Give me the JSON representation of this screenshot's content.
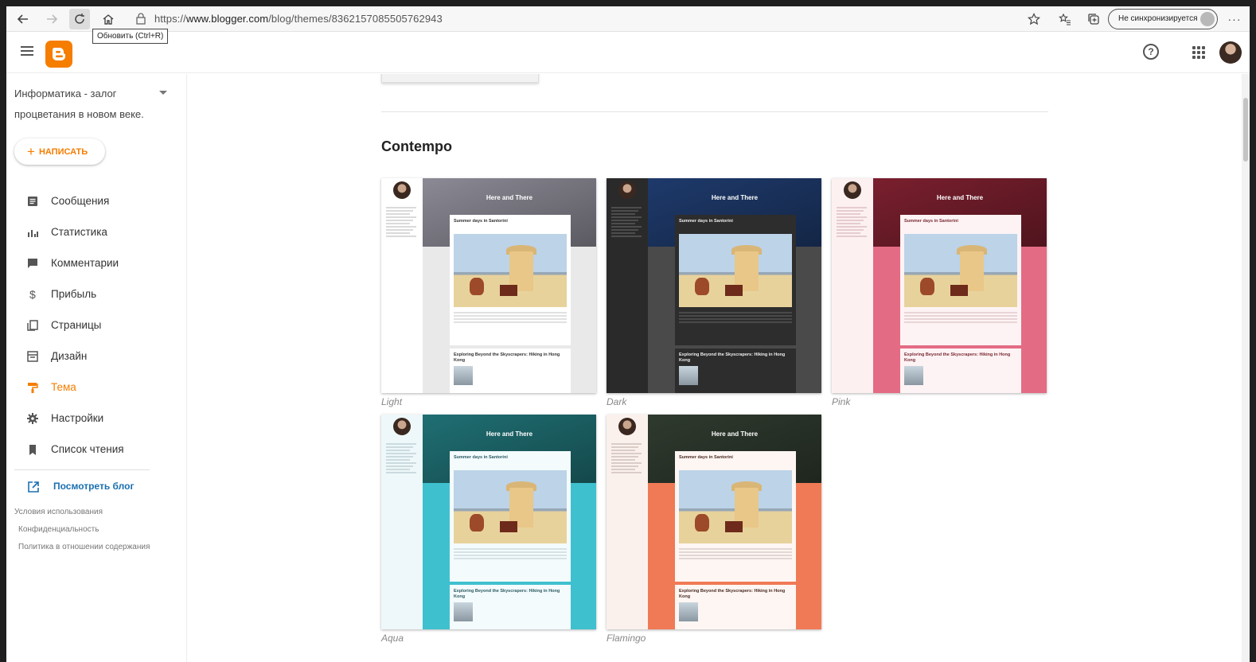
{
  "browser": {
    "url_prefix": "https://",
    "url_domain": "www.blogger.com",
    "url_path": "/blog/themes/8362157085505762943",
    "tooltip": "Обновить (Ctrl+R)",
    "sync_label": "Не синхронизируется",
    "icons": [
      "back-icon",
      "forward-icon",
      "refresh-icon",
      "home-icon",
      "lock-icon",
      "star-icon",
      "favorites-icon",
      "collections-icon",
      "more-icon"
    ]
  },
  "sidebar": {
    "blog_name": "Информатика - залог процветания в новом веке.",
    "write_label": "НАПИСАТЬ",
    "items": [
      {
        "label": "Сообщения",
        "icon": "posts-icon"
      },
      {
        "label": "Статистика",
        "icon": "stats-icon"
      },
      {
        "label": "Комментарии",
        "icon": "comments-icon"
      },
      {
        "label": "Прибыль",
        "icon": "dollar-icon"
      },
      {
        "label": "Страницы",
        "icon": "pages-icon"
      },
      {
        "label": "Дизайн",
        "icon": "layout-icon"
      },
      {
        "label": "Тема",
        "icon": "paint-roller-icon",
        "active": true
      },
      {
        "label": "Настройки",
        "icon": "gear-icon"
      },
      {
        "label": "Список чтения",
        "icon": "bookmark-icon"
      }
    ],
    "view_blog": "Посмотреть блог",
    "footer": [
      "Условия использования",
      "Конфиденциальность",
      "Политика в отношении содержания"
    ]
  },
  "main": {
    "section_title": "Contempo",
    "themes": [
      {
        "name": "Light",
        "hero_title": "Here and There",
        "post1": "Summer days in Santorini",
        "post2": "Exploring Beyond the Skyscrapers: Hiking in Hong Kong",
        "colors": {
          "side": "#ffffff",
          "hero": "#8b8a95",
          "lower": "#e9e9e9",
          "post": "#ffffff",
          "ink": "#333333"
        }
      },
      {
        "name": "Dark",
        "hero_title": "Here and There",
        "post1": "Summer days in Santorini",
        "post2": "Exploring Beyond the Skyscrapers: Hiking in Hong Kong",
        "colors": {
          "side": "#2a2a2a",
          "hero": "#1e3a6b",
          "lower": "#4a4a4a",
          "post": "#2d2d2d",
          "ink": "#eeeeee"
        }
      },
      {
        "name": "Pink",
        "hero_title": "Here and There",
        "post1": "Summer days in Santorini",
        "post2": "Exploring Beyond the Skyscrapers: Hiking in Hong Kong",
        "colors": {
          "side": "#fdf0f1",
          "hero": "#7a1f2e",
          "lower": "#e36c84",
          "post": "#fdf3f4",
          "ink": "#7a2a35"
        }
      },
      {
        "name": "Aqua",
        "hero_title": "Here and There",
        "post1": "Summer days in Santorini",
        "post2": "Exploring Beyond the Skyscrapers: Hiking in Hong Kong",
        "colors": {
          "side": "#eef8fa",
          "hero": "#1f6f73",
          "lower": "#3fc0cf",
          "post": "#f4fbfc",
          "ink": "#2a5a63"
        }
      },
      {
        "name": "Flamingo",
        "hero_title": "Here and There",
        "post1": "Summer days in Santorini",
        "post2": "Exploring Beyond the Skyscrapers: Hiking in Hong Kong",
        "colors": {
          "side": "#fbf1ec",
          "hero": "#2f3a2e",
          "lower": "#f07a55",
          "post": "#fdf6f3",
          "ink": "#4a2a22"
        }
      }
    ]
  }
}
